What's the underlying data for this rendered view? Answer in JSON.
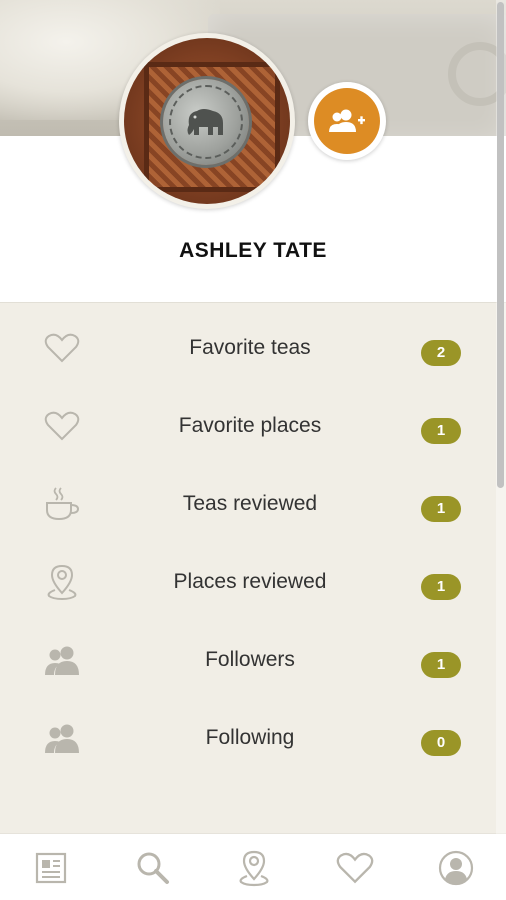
{
  "profile": {
    "name": "ASHLEY TATE"
  },
  "stats": [
    {
      "label": "Favorite teas",
      "count": "2",
      "icon": "heart-icon"
    },
    {
      "label": "Favorite places",
      "count": "1",
      "icon": "heart-icon"
    },
    {
      "label": "Teas reviewed",
      "count": "1",
      "icon": "tea-cup-icon"
    },
    {
      "label": "Places reviewed",
      "count": "1",
      "icon": "map-pin-icon"
    },
    {
      "label": "Followers",
      "count": "1",
      "icon": "users-icon"
    },
    {
      "label": "Following",
      "count": "0",
      "icon": "users-icon"
    }
  ],
  "bottom_nav": [
    {
      "icon": "news-icon"
    },
    {
      "icon": "search-icon"
    },
    {
      "icon": "location-icon"
    },
    {
      "icon": "heart-icon"
    },
    {
      "icon": "profile-icon"
    }
  ],
  "colors": {
    "accent_orange": "#dd8c24",
    "badge_olive": "#9a9527",
    "list_background": "#f1eee6",
    "icon_gray": "#b9b6ad"
  }
}
